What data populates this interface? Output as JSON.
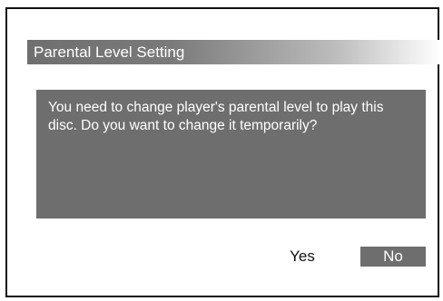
{
  "dialog": {
    "title": "Parental Level Setting",
    "message": "You need to change player's parental level to play this disc. Do you want to change it temporarily?",
    "buttons": {
      "yes_label": "Yes",
      "no_label": "No",
      "selected": "No"
    }
  },
  "colors": {
    "background": "#ffffff",
    "frame": "#111111",
    "panel": "#6e6e6e",
    "text_on_panel": "#ffffff",
    "text_on_background": "#111111"
  }
}
